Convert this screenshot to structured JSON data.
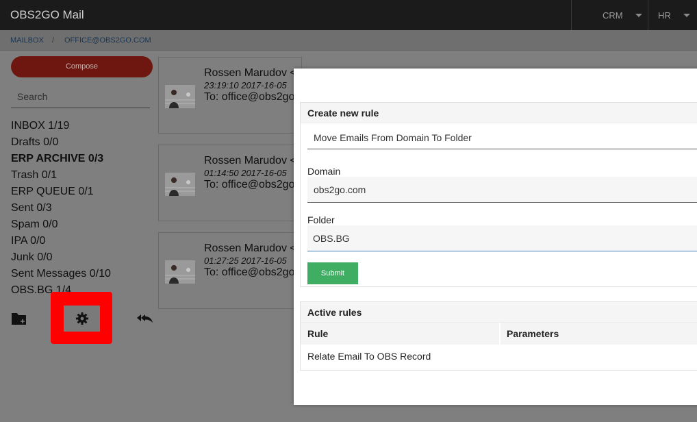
{
  "app": {
    "title": "OBS2GO Mail"
  },
  "topnav": {
    "crm": "CRM",
    "hr": "HR"
  },
  "breadcrumb": {
    "mailbox": "MAILBOX",
    "separator": "/",
    "account": "OFFICE@OBS2GO.COM"
  },
  "sidebar": {
    "compose": "Compose",
    "search_placeholder": "Search",
    "folders": [
      {
        "label": "INBOX 1/19",
        "bold": false
      },
      {
        "label": "Drafts 0/0",
        "bold": false
      },
      {
        "label": "ERP ARCHIVE 0/3",
        "bold": true
      },
      {
        "label": "Trash 0/1",
        "bold": false
      },
      {
        "label": "ERP QUEUE 0/1",
        "bold": false
      },
      {
        "label": "Sent 0/3",
        "bold": false
      },
      {
        "label": "Spam 0/0",
        "bold": false
      },
      {
        "label": "IPA 0/0",
        "bold": false
      },
      {
        "label": "Junk 0/0",
        "bold": false
      },
      {
        "label": "Sent Messages 0/10",
        "bold": false
      },
      {
        "label": "OBS.BG 1/4",
        "bold": false
      }
    ],
    "icons": {
      "new_folder": "folder-plus-icon",
      "settings": "gear-icon",
      "reply_all": "reply-all-icon"
    },
    "highlight_color": "#ff0000"
  },
  "emails": [
    {
      "from": "Rossen Marudov <",
      "time": "23:19:10 2017-16-05",
      "to": "To: office@obs2go"
    },
    {
      "from": "Rossen Marudov <",
      "time": "01:14:50 2017-16-05",
      "to": "To: office@obs2go"
    },
    {
      "from": "Rossen Marudov <",
      "time": "01:27:25 2017-16-05",
      "to": "To: office@obs2go"
    }
  ],
  "modal": {
    "create": {
      "title": "Create new rule",
      "rule_type": "Move Emails From Domain To Folder",
      "domain_label": "Domain",
      "domain_value": "obs2go.com",
      "folder_label": "Folder",
      "folder_value": "OBS.BG",
      "submit": "Submit",
      "submit_color": "#3fae63"
    },
    "active": {
      "title": "Active rules",
      "columns": [
        "Rule",
        "Parameters"
      ],
      "rows": [
        {
          "rule": "Relate Email To OBS Record",
          "parameters": ""
        }
      ]
    }
  }
}
